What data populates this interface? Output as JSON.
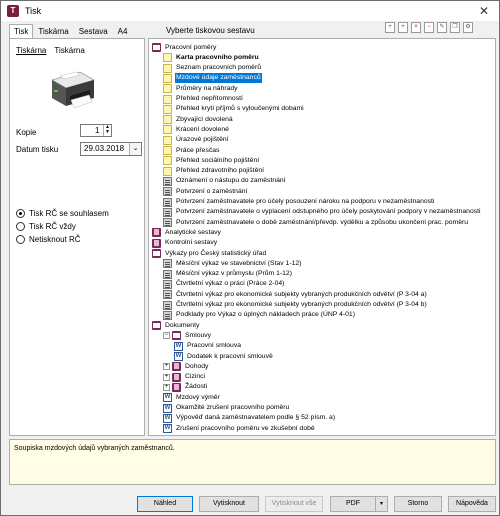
{
  "window": {
    "title": "Tisk",
    "app_icon": "T"
  },
  "tabs": [
    "Tisk",
    "Tiskárna",
    "Sestava",
    "A4"
  ],
  "left": {
    "subtabs": [
      "Tiskárna",
      "Tiskárna"
    ],
    "copies_label": "Kopie",
    "copies_value": "1",
    "date_label": "Datum tisku",
    "date_value": "29.03.2018",
    "radios": [
      "Tisk RČ se souhlasem",
      "Tisk RČ vždy",
      "Netisknout RČ"
    ],
    "radio_checked": 0
  },
  "tree_header": "Vyberte tiskovou sestavu",
  "toolbar_icons": [
    "add-icon",
    "add-icon",
    "delete-icon",
    "remove-icon",
    "edit-icon",
    "copy-icon",
    "settings-icon"
  ],
  "tree": [
    {
      "label": "Pracovní poměry",
      "icon": "bookopen",
      "indent": 0,
      "expander": ""
    },
    {
      "label": "Karta pracovního poměru",
      "icon": "yellow",
      "indent": 1,
      "bold": true
    },
    {
      "label": "Seznam pracovních poměrů",
      "icon": "yellow",
      "indent": 1
    },
    {
      "label": "Mzdové údaje zaměstnanců",
      "icon": "yellow",
      "indent": 1,
      "selected": true
    },
    {
      "label": "Průměry na náhrady",
      "icon": "yellow",
      "indent": 1
    },
    {
      "label": "Přehled nepřítomností",
      "icon": "yellow",
      "indent": 1
    },
    {
      "label": "Přehled krytí příjmů s vyloučenými dobami",
      "icon": "yellow",
      "indent": 1
    },
    {
      "label": "Zbývající dovolená",
      "icon": "yellow",
      "indent": 1
    },
    {
      "label": "Krácení dovolené",
      "icon": "yellow",
      "indent": 1
    },
    {
      "label": "Úrazové pojištění",
      "icon": "yellow",
      "indent": 1
    },
    {
      "label": "Práce přesčas",
      "icon": "yellow",
      "indent": 1
    },
    {
      "label": "Přehled sociálního pojištění",
      "icon": "yellow",
      "indent": 1
    },
    {
      "label": "Přehled zdravotního pojištění",
      "icon": "yellow",
      "indent": 1
    },
    {
      "label": "Oznámení o nástupu do zaměstnání",
      "icon": "gray",
      "indent": 1
    },
    {
      "label": "Potvrzení o zaměstnání",
      "icon": "gray",
      "indent": 1
    },
    {
      "label": "Potvrzení zaměstnavatele pro účely posouzení nároku na podporu v nezaměstnanosti",
      "icon": "gray",
      "indent": 1
    },
    {
      "label": "Potvrzení zaměstnavatele o vyplacení odstupného pro účely poskytování podpory v nezaměstnanosti",
      "icon": "gray",
      "indent": 1
    },
    {
      "label": "Potvrzení zaměstnavatele o době zaměstnání/převdp. výdělku a způsobu ukončení prac. poměru",
      "icon": "gray",
      "indent": 1
    },
    {
      "label": "Analytické sestavy",
      "icon": "book",
      "indent": 0
    },
    {
      "label": "Kontrolní sestavy",
      "icon": "book",
      "indent": 0
    },
    {
      "label": "Výkazy pro Český statistický úřad",
      "icon": "bookopen",
      "indent": 0
    },
    {
      "label": "Měsíční výkaz ve stavebnictví (Stav 1-12)",
      "icon": "gray",
      "indent": 1
    },
    {
      "label": "Měsíční výkaz v průmyslu (Prům 1-12)",
      "icon": "gray",
      "indent": 1
    },
    {
      "label": "Čtvrtletní výkaz o práci (Práce 2-04)",
      "icon": "gray",
      "indent": 1
    },
    {
      "label": "Čtvrtletní výkaz pro ekonomické subjekty vybraných produkčních odvětví (P 3-04 a)",
      "icon": "gray",
      "indent": 1
    },
    {
      "label": "Čtvrtletní výkaz pro ekonomické subjekty vybraných produkčních odvětví (P 3-04 b)",
      "icon": "gray",
      "indent": 1
    },
    {
      "label": "Podklady pro Výkaz o úplných nákladech práce (ÚNP 4-01)",
      "icon": "gray",
      "indent": 1
    },
    {
      "label": "Dokumenty",
      "icon": "bookopen",
      "indent": 0
    },
    {
      "label": "Smlouvy",
      "icon": "bookopen",
      "indent": 1,
      "expander": "−"
    },
    {
      "label": "Pracovní smlouva",
      "icon": "word",
      "indent": 2
    },
    {
      "label": "Dodatek k pracovní smlouvě",
      "icon": "word",
      "indent": 2
    },
    {
      "label": "Dohody",
      "icon": "book",
      "indent": 1,
      "expander": "+"
    },
    {
      "label": "Cizinci",
      "icon": "book",
      "indent": 1,
      "expander": "+"
    },
    {
      "label": "Žádosti",
      "icon": "book",
      "indent": 1,
      "expander": "+"
    },
    {
      "label": "Mzdový výměr",
      "icon": "word",
      "indent": 1
    },
    {
      "label": "Okamžité zrušení pracovního poměru",
      "icon": "word",
      "indent": 1
    },
    {
      "label": "Výpověď daná zaměstnavatelem podle § 52 písm. a)",
      "icon": "word",
      "indent": 1
    },
    {
      "label": "Zrušení pracovního poměru ve zkušební době",
      "icon": "word",
      "indent": 1
    }
  ],
  "description": "Soupiska mzdových údajů vybraných zaměstnanců.",
  "buttons": {
    "preview": "Náhled",
    "print": "Vytisknout",
    "print_all": "Vytisknout vše",
    "pdf": "PDF",
    "cancel": "Storno",
    "help": "Nápověda"
  }
}
